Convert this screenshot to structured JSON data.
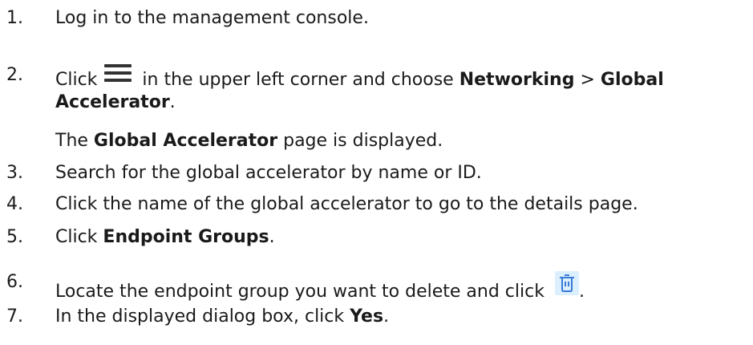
{
  "steps": [
    {
      "number": "1.",
      "text": "Log in to the management console."
    },
    {
      "number": "2.",
      "pre": "Click",
      "post": "in the upper left corner and choose",
      "bold1": "Networking",
      "sep": ">",
      "bold2": "Global",
      "line2_bold": "Accelerator",
      "line2_end": ".",
      "note_pre": "The",
      "note_bold": "Global Accelerator",
      "note_post": "page is displayed."
    },
    {
      "number": "3.",
      "text": "Search for the global accelerator by name or ID."
    },
    {
      "number": "4.",
      "text": "Click the name of the global accelerator to go to the details page."
    },
    {
      "number": "5.",
      "pre": "Click",
      "bold": "Endpoint Groups",
      "post": "."
    },
    {
      "number": "6.",
      "text": "Locate the endpoint group you want to delete and click",
      "post": "."
    },
    {
      "number": "7.",
      "pre": "In the displayed dialog box, click",
      "bold": "Yes",
      "post": "."
    }
  ],
  "icons": {
    "menu": "menu-icon",
    "delete": "trash-icon",
    "trash_color": "#3a7bd5",
    "trash_bg": "#dcefff"
  }
}
